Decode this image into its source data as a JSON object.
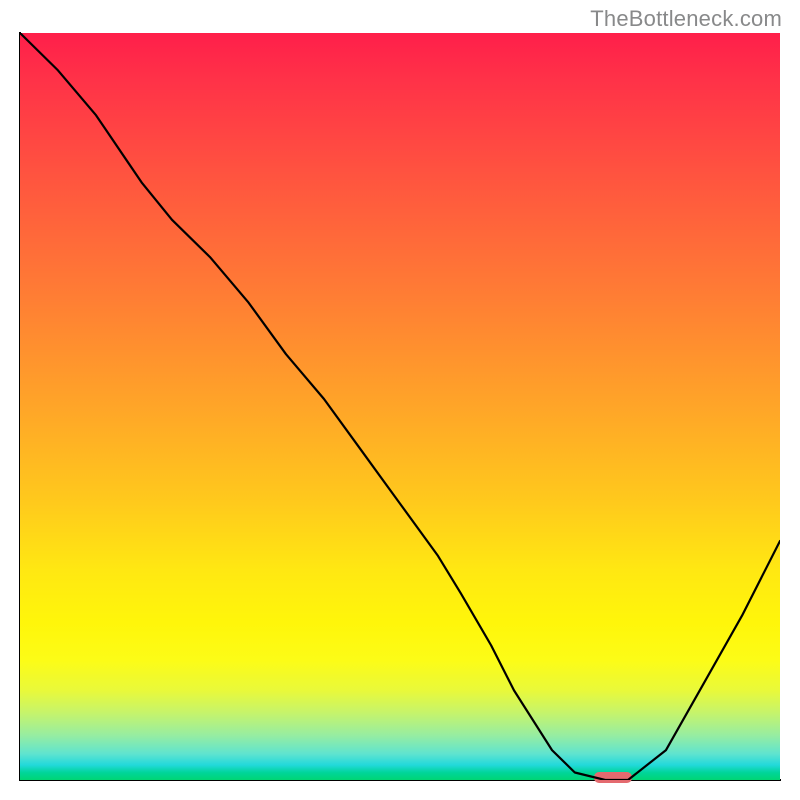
{
  "watermark": "TheBottleneck.com",
  "colors": {
    "curve": "#000000",
    "marker": "#e46a6f",
    "gradient_top": "#ff1f4a",
    "gradient_bottom": "#00d574"
  },
  "chart_data": {
    "type": "line",
    "title": "",
    "xlabel": "",
    "ylabel": "",
    "xlim": [
      0,
      100
    ],
    "ylim": [
      0,
      100
    ],
    "x": [
      0,
      5,
      10,
      16,
      20,
      25,
      30,
      35,
      40,
      45,
      50,
      55,
      58,
      62,
      65,
      70,
      73,
      77,
      80,
      85,
      90,
      95,
      100
    ],
    "values": [
      100,
      95,
      89,
      80,
      75,
      70,
      64,
      57,
      51,
      44,
      37,
      30,
      25,
      18,
      12,
      4,
      1,
      0,
      0,
      4,
      13,
      22,
      32
    ],
    "marker": {
      "x_start": 75.5,
      "x_end": 80.5,
      "y": 0
    },
    "annotations": []
  }
}
